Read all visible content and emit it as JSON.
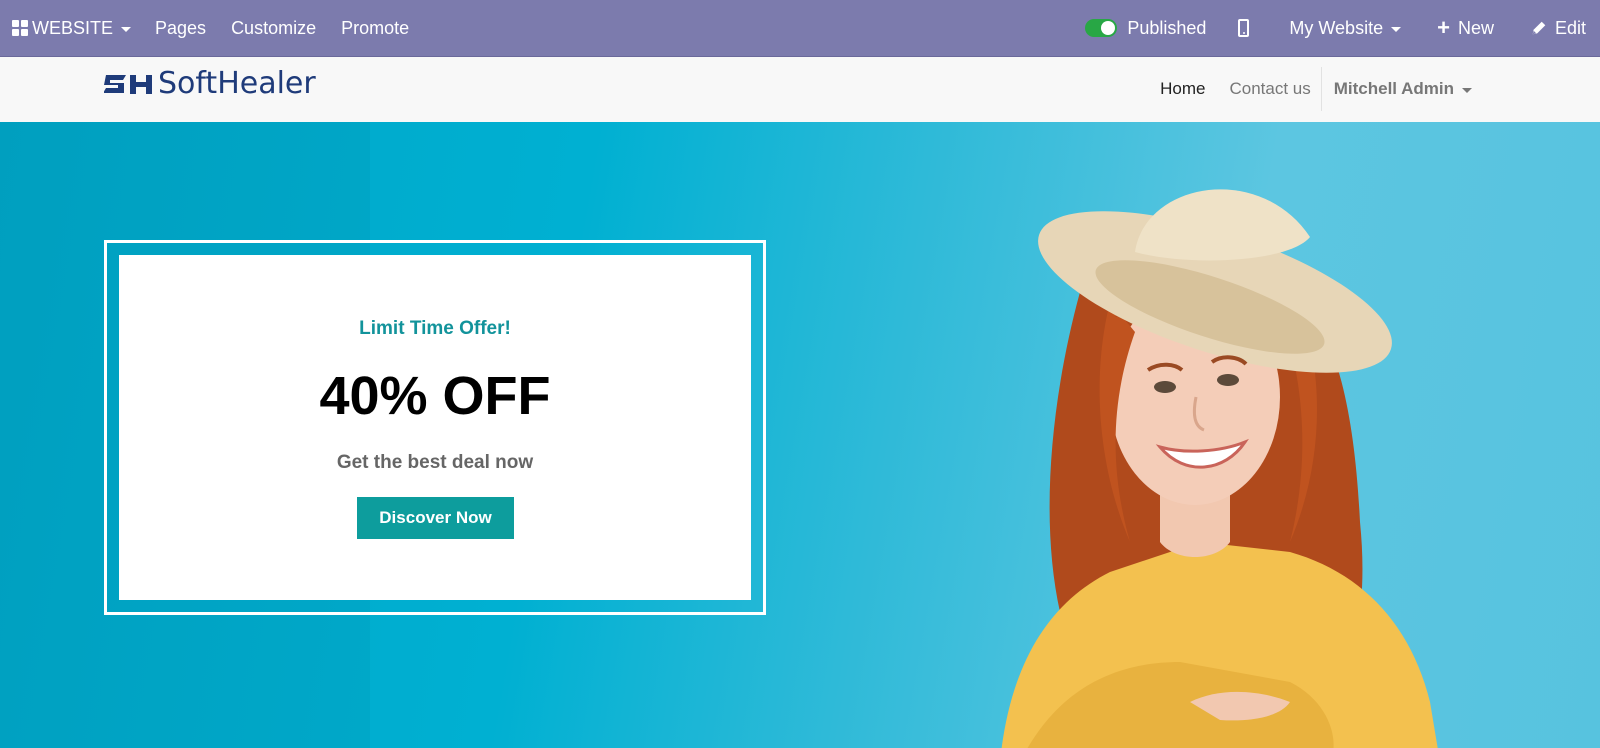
{
  "admin_bar": {
    "website_menu": "WEBSITE",
    "pages": "Pages",
    "customize": "Customize",
    "promote": "Promote",
    "published": "Published",
    "my_website": "My Website",
    "new": "New",
    "edit": "Edit",
    "bar_color": "#7c7bad",
    "toggle_color": "#28a745"
  },
  "site_header": {
    "logo_mark": "SH",
    "logo_text": "SoftHealer",
    "nav": {
      "home": "Home",
      "contact": "Contact us",
      "user": "Mitchell Admin"
    }
  },
  "hero": {
    "kicker": "Limit Time Offer!",
    "headline": "40% OFF",
    "subtitle": "Get the best deal now",
    "cta": "Discover Now",
    "accent_color": "#0d9d9d",
    "background_color": "#00b0d2"
  },
  "icons": {
    "apps": "apps-grid-icon",
    "mobile": "mobile-preview-icon",
    "plus": "plus-icon",
    "pencil": "pencil-icon",
    "caret": "caret-down-icon"
  }
}
